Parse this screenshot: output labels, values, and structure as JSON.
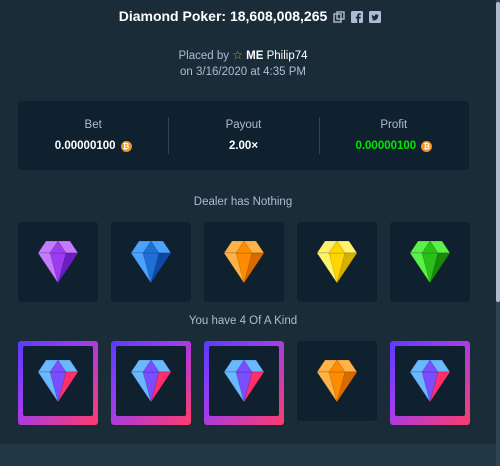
{
  "header": {
    "title": "Diamond Poker: 18,608,008,265",
    "icons": [
      "copy-icon",
      "facebook-icon",
      "twitter-icon"
    ]
  },
  "placed": {
    "prefix": "Placed by",
    "rank": "ME",
    "username": "Philip74",
    "date_line": "on 3/16/2020 at 4:35 PM"
  },
  "stats": {
    "bet_label": "Bet",
    "bet_value": "0.00000100",
    "payout_label": "Payout",
    "payout_value": "2.00×",
    "profit_label": "Profit",
    "profit_value": "0.00000100",
    "currency_symbol": "₿"
  },
  "dealer": {
    "title": "Dealer has Nothing",
    "gems": [
      "purple",
      "blue",
      "orange",
      "yellow",
      "green"
    ]
  },
  "player": {
    "title": "You have 4 Of A Kind",
    "gems": [
      "pink",
      "pink",
      "pink",
      "orange",
      "pink"
    ],
    "winning": [
      true,
      true,
      true,
      false,
      true
    ]
  },
  "colors": {
    "background": "#1a2c38",
    "panel": "#0f212e",
    "profit": "#00e701",
    "purple": "#9b3cf0",
    "blue": "#1f6fd6",
    "orange": "#ff8c00",
    "yellow": "#ffd600",
    "green": "#2bbf1a",
    "pink": "#ff3c6b"
  }
}
